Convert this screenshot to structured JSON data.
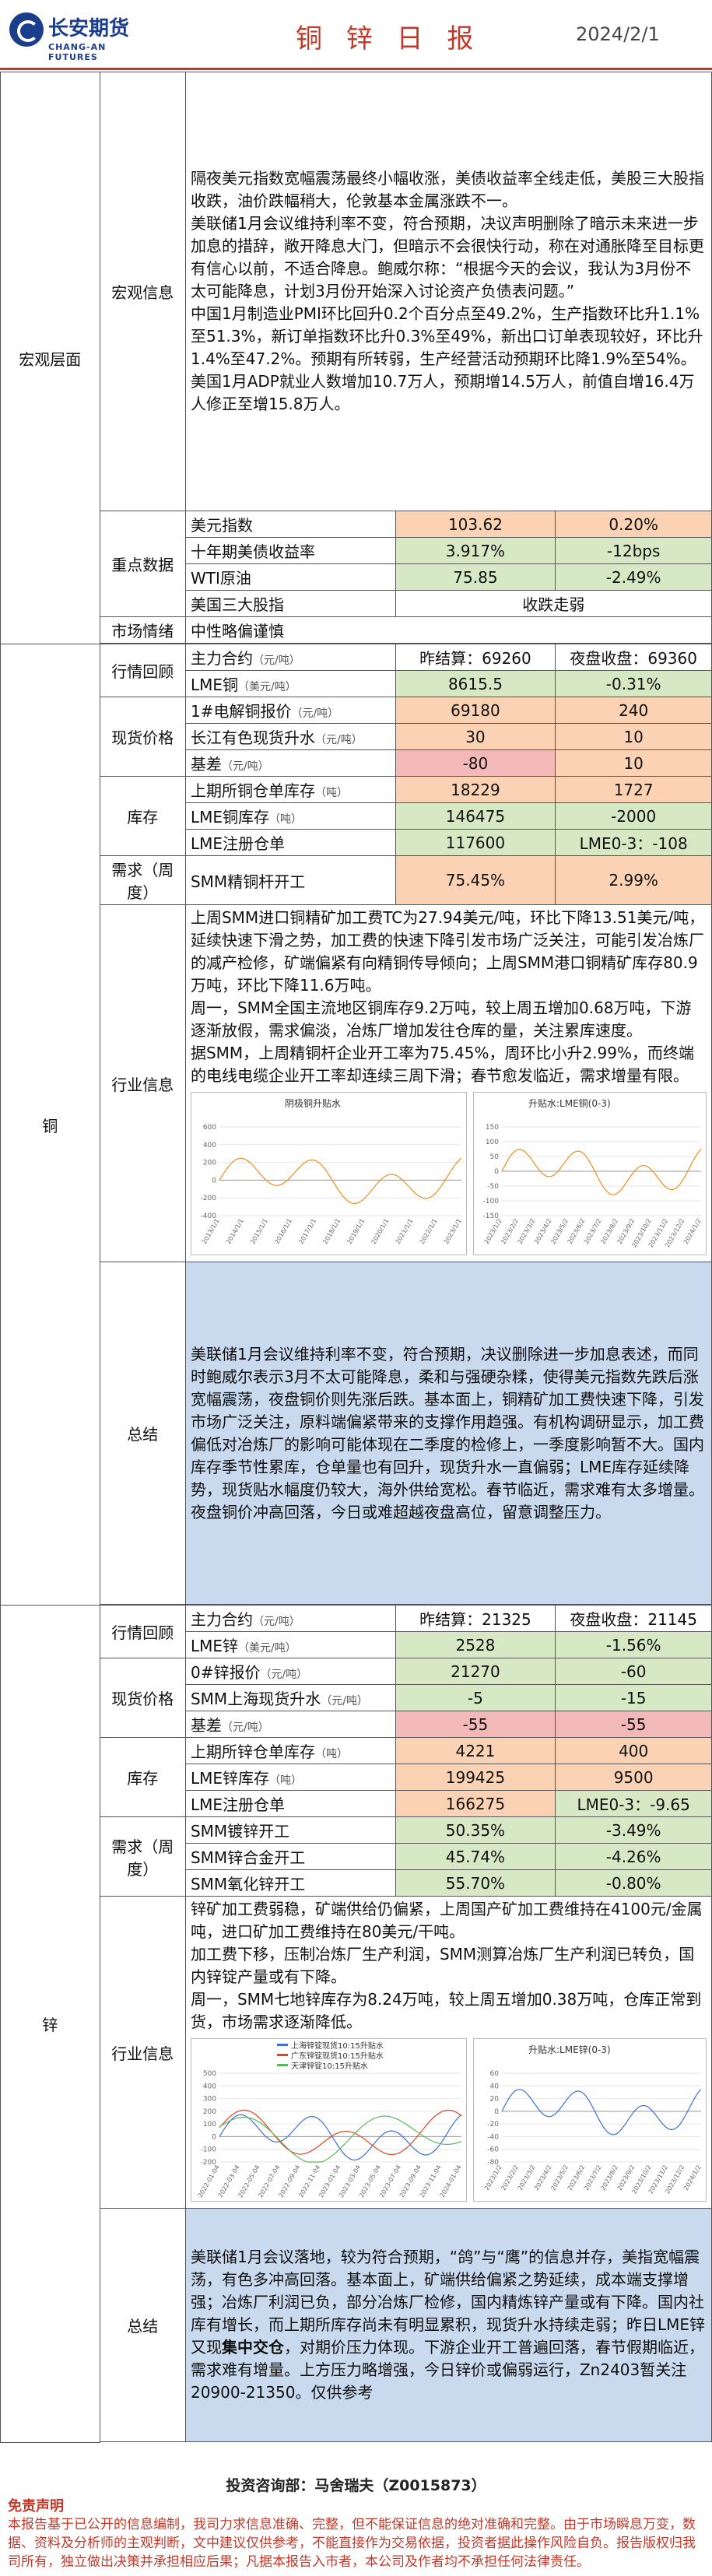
{
  "header": {
    "logo_cn": "长安期货",
    "logo_en": "CHANG-AN FUTURES",
    "title": "铜 锌 日 报",
    "date": "2024/2/1"
  },
  "macro": {
    "category": "宏观层面",
    "info_label": "宏观信息",
    "info_paragraphs": [
      "隔夜美元指数宽幅震荡最终小幅收涨，美债收益率全线走低，美股三大股指收跌，油价跌幅稍大，伦敦基本金属涨跌不一。",
      "美联储1月会议维持利率不变，符合预期，决议声明删除了暗示未来进一步加息的措辞，敞开降息大门，但暗示不会很快行动，称在对通胀降至目标更有信心以前，不适合降息。鲍威尔称：“根据今天的会议，我认为3月份不太可能降息，计划3月份开始深入讨论资产负债表问题。”",
      "中国1月制造业PMI环比回升0.2个百分点至49.2%，生产指数环比升1.1%至51.3%，新订单指数环比升0.3%至49%，新出口订单表现较好，环比升1.4%至47.2%。预期有所转弱，生产经营活动预期环比降1.9%至54%。",
      "美国1月ADP就业人数增加10.7万人，预期增14.5万人，前值自增16.4万人修正至增15.8万人。"
    ],
    "key_label": "重点数据",
    "key_rows": [
      {
        "name": "美元指数",
        "v1": "103.62",
        "v2": "0.20%"
      },
      {
        "name": "十年期美债收益率",
        "v1": "3.917%",
        "v2": "-12bps"
      },
      {
        "name": "WTI原油",
        "v1": "75.85",
        "v2": "-2.49%"
      },
      {
        "name": "美国三大股指",
        "v1": "收跌走弱",
        "v2": ""
      }
    ],
    "sentiment_label": "市场情绪",
    "sentiment": "中性略偏谨慎"
  },
  "copper": {
    "category": "铜",
    "review_label": "行情回顾",
    "review_rows": [
      {
        "name": "主力合约",
        "unit": "（元/吨）",
        "v1": "昨结算：69260",
        "v2": "夜盘收盘：69360"
      },
      {
        "name": "LME铜",
        "unit": "（美元/吨）",
        "v1": "8615.5",
        "v2": "-0.31%"
      }
    ],
    "spot_label": "现货价格",
    "spot_rows": [
      {
        "name": "1#电解铜报价",
        "unit": "（元/吨）",
        "v1": "69180",
        "v2": "240"
      },
      {
        "name": "长江有色现货升水",
        "unit": "（元/吨）",
        "v1": "30",
        "v2": "10"
      },
      {
        "name": "基差",
        "unit": "（元/吨）",
        "v1": "-80",
        "v2": "10"
      }
    ],
    "stock_label": "库存",
    "stock_rows": [
      {
        "name": "上期所铜仓单库存",
        "unit": "（吨）",
        "v1": "18229",
        "v2": "1727"
      },
      {
        "name": "LME铜库存",
        "unit": "（吨）",
        "v1": "146475",
        "v2": "-2000"
      },
      {
        "name": "LME注册仓单",
        "unit": "",
        "v1": "117600",
        "v2": "LME0-3：-108"
      }
    ],
    "demand_label": "需求（周度）",
    "demand_rows": [
      {
        "name": "SMM精铜杆开工",
        "unit": "",
        "v1": "75.45%",
        "v2": "2.99%"
      }
    ],
    "industry_label": "行业信息",
    "industry_paragraphs": [
      "上周SMM进口铜精矿加工费TC为27.94美元/吨，环比下降13.51美元/吨，延续快速下滑之势，加工费的快速下降引发市场广泛关注，可能引发冶炼厂的减产检修，矿端偏紧有向精铜传导倾向；上周SMM港口铜精矿库存80.9万吨，环比下降11.6万吨。",
      "周一，SMM全国主流地区铜库存9.2万吨，较上周五增加0.68万吨，下游逐渐放假，需求偏淡，冶炼厂增加发往仓库的量，关注累库速度。",
      "据SMM，上周精铜杆企业开工率为75.45%，周环比小升2.99%，而终端的电线电缆企业开工率却连续三周下滑；春节愈发临近，需求增量有限。"
    ],
    "chart1_title": "阴极铜升贴水",
    "chart2_title": "升贴水:LME铜(0-3)",
    "chart1_xlabels": [
      "2013/1/1",
      "2014/1/1",
      "2015/1/1",
      "2016/1/1",
      "2017/1/1",
      "2018/1/1",
      "2019/1/1",
      "2020/1/1",
      "2021/1/1",
      "2022/1/1",
      "2023/1/1"
    ],
    "chart2_xlabels": [
      "2023/1/2",
      "2023/2/2",
      "2023/3/2",
      "2023/4/2",
      "2023/5/2",
      "2023/6/2",
      "2023/7/2",
      "2023/8/2",
      "2023/9/2",
      "2023/10/2",
      "2023/11/2",
      "2023/12/2",
      "2024/1/2"
    ],
    "chart1_ylabels": [
      "600",
      "400",
      "200",
      "0",
      "-200",
      "-400"
    ],
    "chart2_ylabels": [
      "150",
      "100",
      "50",
      "0",
      "-50",
      "-100",
      "-150"
    ],
    "summary_label": "总结",
    "summary": "美联储1月会议维持利率不变，符合预期，决议删除进一步加息表述，而同时鲍威尔表示3月不太可能降息，柔和与强硬杂糅，使得美元指数先跌后涨宽幅震荡，夜盘铜价则先涨后跌。基本面上，铜精矿加工费快速下降，引发市场广泛关注，原料端偏紧带来的支撑作用趋强。有机构调研显示，加工费偏低对冶炼厂的影响可能体现在二季度的检修上，一季度影响暂不大。国内库存季节性累库，仓单量也有回升，现货升水一直偏弱；LME库存延续降势，现货贴水幅度仍较大，海外供给宽松。春节临近，需求难有太多增量。夜盘铜价冲高回落，今日或难超越夜盘高位，留意调整压力。"
  },
  "zinc": {
    "category": "锌",
    "review_label": "行情回顾",
    "review_rows": [
      {
        "name": "主力合约",
        "unit": "（元/吨）",
        "v1": "昨结算：21325",
        "v2": "夜盘收盘：21145"
      },
      {
        "name": "LME锌",
        "unit": "（美元/吨）",
        "v1": "2528",
        "v2": "-1.56%"
      }
    ],
    "spot_label": "现货价格",
    "spot_rows": [
      {
        "name": "0#锌报价",
        "unit": "（元/吨）",
        "v1": "21270",
        "v2": "-60"
      },
      {
        "name": "SMM上海现货升水",
        "unit": "（元/吨）",
        "v1": "-5",
        "v2": "-15"
      },
      {
        "name": "基差",
        "unit": "（元/吨）",
        "v1": "-55",
        "v2": "-55"
      }
    ],
    "stock_label": "库存",
    "stock_rows": [
      {
        "name": "上期所锌仓单库存",
        "unit": "（吨）",
        "v1": "4221",
        "v2": "400"
      },
      {
        "name": "LME锌库存",
        "unit": "（吨）",
        "v1": "199425",
        "v2": "9500"
      },
      {
        "name": "LME注册仓单",
        "unit": "",
        "v1": "166275",
        "v2": "LME0-3：-9.65"
      }
    ],
    "demand_label": "需求（周度）",
    "demand_rows": [
      {
        "name": "SMM镀锌开工",
        "unit": "",
        "v1": "50.35%",
        "v2": "-3.49%"
      },
      {
        "name": "SMM锌合金开工",
        "unit": "",
        "v1": "45.74%",
        "v2": "-4.26%"
      },
      {
        "name": "SMM氧化锌开工",
        "unit": "",
        "v1": "55.70%",
        "v2": "-0.80%"
      }
    ],
    "industry_label": "行业信息",
    "industry_paragraphs": [
      "锌矿加工费弱稳，矿端供给仍偏紧，上周国产矿加工费维持在4100元/金属吨，进口矿加工费维持在80美元/干吨。",
      "加工费下移，压制冶炼厂生产利润，SMM测算冶炼厂生产利润已转负，国内锌锭产量或有下降。",
      "周一，SMM七地锌库存为8.24万吨，较上周五增加0.38万吨，仓库正常到货，市场需求逐渐降低。"
    ],
    "chart1_legend": [
      "上海锌锭现货10:15升贴水",
      "广东锌锭现货10:15升贴水",
      "天津锌锭10:15升贴水"
    ],
    "chart2_title": "升贴水:LME锌(0-3)",
    "chart1_xlabels": [
      "2022-01-04",
      "2022-03-04",
      "2022-05-04",
      "2022-07-04",
      "2022-09-04",
      "2022-11-04",
      "2023-01-04",
      "2023-03-04",
      "2023-05-04",
      "2023-07-04",
      "2023-09-04",
      "2023-11-04",
      "2024-01-04"
    ],
    "chart2_xlabels": [
      "2023/1/2",
      "2023/2/2",
      "2023/3/2",
      "2023/4/2",
      "2023/5/2",
      "2023/6/2",
      "2023/7/2",
      "2023/8/2",
      "2023/9/2",
      "2023/10/2",
      "2023/11/2",
      "2023/12/2",
      "2024/1/2"
    ],
    "chart1_ylabels": [
      "500",
      "400",
      "300",
      "200",
      "100",
      "0",
      "-100",
      "-200"
    ],
    "chart2_ylabels": [
      "60",
      "40",
      "20",
      "0",
      "-20",
      "-40",
      "-60",
      "-80"
    ],
    "summary_label": "总结",
    "summary_a": "美联储1月会议落地，较为符合预期，“鸽”与“鹰”的信息并存，美指宽幅震荡，有色多冲高回落。基本面上，矿端供给偏紧之势延续，成本端支撑增强；冶炼厂利润已负，部分冶炼厂检修，国内精炼锌产量或有下降。国内社库有增长，而上期所库存尚未有明显累积，现货升水持续走弱；昨日LME锌又现",
    "summary_bold": "集中交仓",
    "summary_b": "，对期价压力体现。下游企业开工普遍回落，春节假期临近，需求难有增量。上方压力略增强，今日锌价或偏弱运行，Zn2403暂关注20900-21350。仅供参考"
  },
  "footer": {
    "contact": "投资咨询部：马舍瑞夫（Z0015873）",
    "disclaimer_title": "免责声明",
    "disclaimer": "本报告基于已公开的信息编制，我司力求信息准确、完整，但不能保证信息的绝对准确和完整。由于市场瞬息万变，数据、资料及分析师的主观判断，文中建议仅供参考，不能直接作为交易依据，投资者据此操作风险自负。报告版权归我司所有，独立做出决策并承担相应后果；凡据本报告入市者，本公司及作者均不承担任何法律责任。"
  }
}
